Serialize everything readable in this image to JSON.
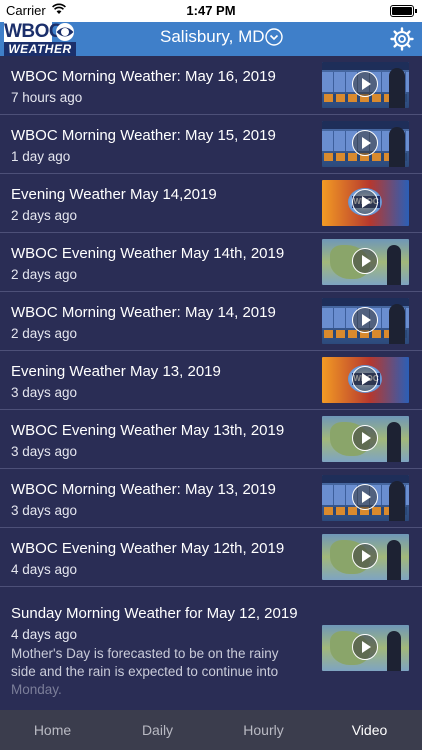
{
  "status_bar": {
    "carrier": "Carrier",
    "time": "1:47 PM"
  },
  "header": {
    "logo_top": "WBOC",
    "logo_bottom": "WEATHER",
    "location": "Salisbury, MD"
  },
  "videos": [
    {
      "title": "WBOC Morning Weather: May 16, 2019",
      "age": "7 hours ago",
      "thumb": "forecast"
    },
    {
      "title": "WBOC Morning Weather: May 15, 2019",
      "age": "1 day ago",
      "thumb": "forecast"
    },
    {
      "title": "Evening Weather May 14,2019",
      "age": "2 days ago",
      "thumb": "studio"
    },
    {
      "title": "WBOC Evening Weather May 14th, 2019",
      "age": "2 days ago",
      "thumb": "map"
    },
    {
      "title": "WBOC Morning Weather: May 14, 2019",
      "age": "2 days ago",
      "thumb": "forecast"
    },
    {
      "title": "Evening Weather May 13, 2019",
      "age": "3 days ago",
      "thumb": "studio"
    },
    {
      "title": "WBOC Evening Weather May 13th, 2019",
      "age": "3 days ago",
      "thumb": "map"
    },
    {
      "title": "WBOC Morning Weather: May 13, 2019",
      "age": "3 days ago",
      "thumb": "forecast"
    },
    {
      "title": "WBOC Evening Weather May 12th, 2019",
      "age": "4 days ago",
      "thumb": "map"
    },
    {
      "title": "Sunday Morning Weather for May 12, 2019",
      "age": "4 days ago",
      "thumb": "map",
      "description": "Mother's Day is forecasted to be on the rainy side and the rain is expected to continue into",
      "description_faded": "Monday."
    }
  ],
  "tabs": [
    {
      "label": "Home",
      "active": false
    },
    {
      "label": "Daily",
      "active": false
    },
    {
      "label": "Hourly",
      "active": false
    },
    {
      "label": "Video",
      "active": true
    }
  ],
  "colors": {
    "background": "#2a2d55",
    "header": "#3f7fc9",
    "tabbar": "#3b3d4d"
  },
  "icons": {
    "location_dropdown": "chevron-down-circle-icon",
    "settings": "gear-icon",
    "play": "play-icon"
  }
}
